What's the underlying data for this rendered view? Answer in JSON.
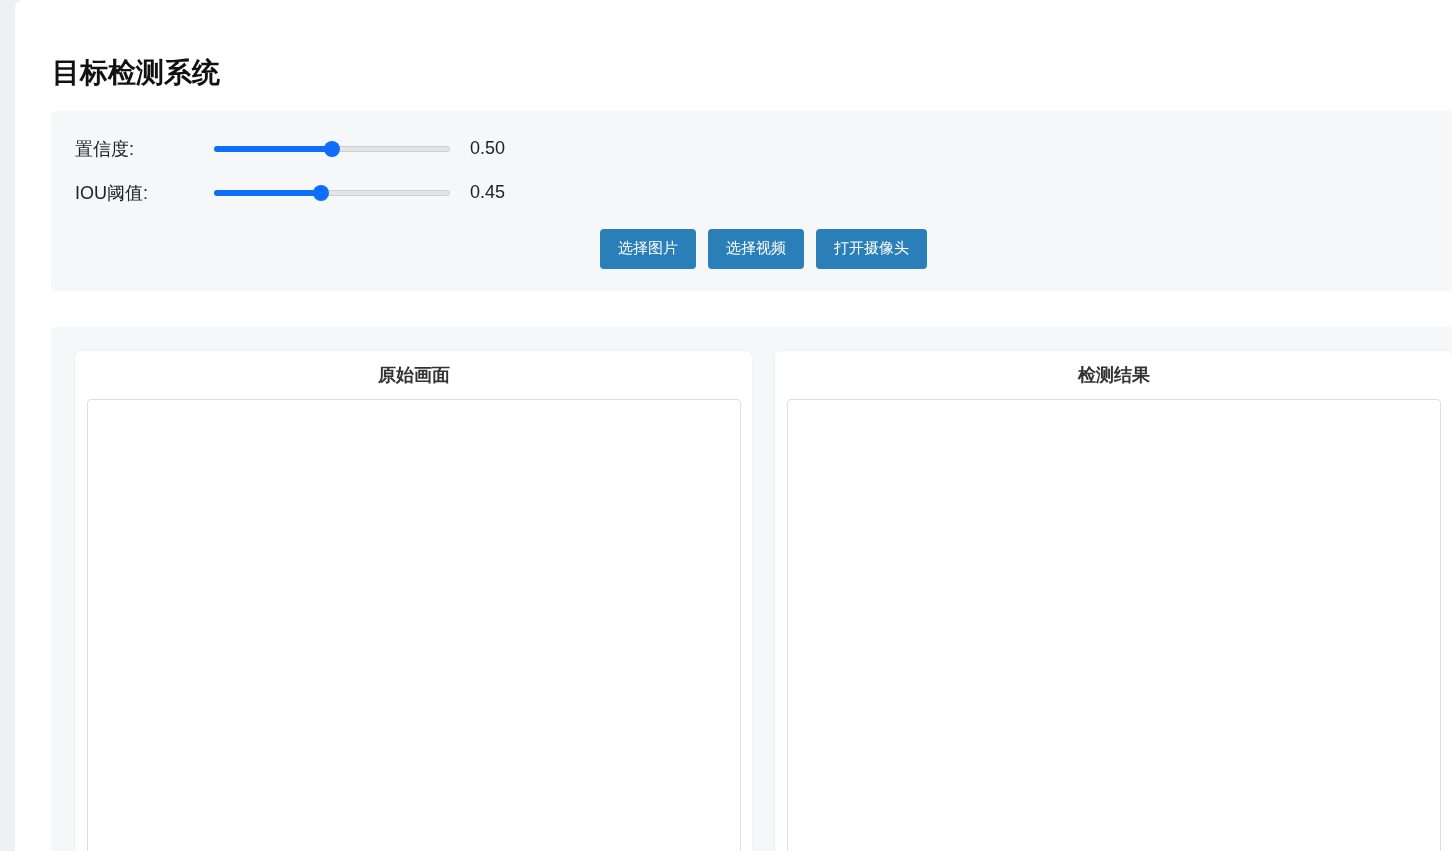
{
  "title": "目标检测系统",
  "controls": [
    {
      "label": "置信度:",
      "level": 0.5,
      "reading": "0.50"
    },
    {
      "label": "IOU阈值:",
      "level": 0.45,
      "reading": "0.45"
    }
  ],
  "buttons": [
    "选择图片",
    "选择视频",
    "打开摄像头"
  ],
  "panels": [
    {
      "title": "原始画面"
    },
    {
      "title": "检测结果"
    }
  ]
}
